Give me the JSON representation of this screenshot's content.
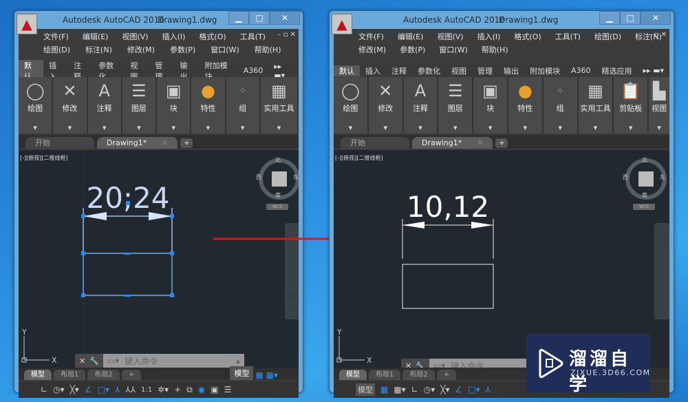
{
  "windows": [
    {
      "title": "Autodesk AutoCAD 2016",
      "doc": "Drawing1.dwg",
      "menu_row1": [
        "文件(F)",
        "编辑(E)",
        "视图(V)",
        "插入(I)",
        "格式(O)",
        "工具(T)"
      ],
      "menu_row2": [
        "绘图(D)",
        "标注(N)",
        "修改(M)",
        "参数(P)",
        "窗口(W)",
        "帮助(H)"
      ],
      "ribbon_tabs": [
        "默认",
        "插入",
        "注释",
        "参数化",
        "视图",
        "管理",
        "输出",
        "附加模块",
        "A360"
      ],
      "panels": [
        "绘图",
        "修改",
        "注释",
        "图层",
        "块",
        "特性",
        "组",
        "实用工具"
      ],
      "doc_tabs": [
        "开始",
        "Drawing1*"
      ],
      "viewport_label": "[-][俯视][二维线框]",
      "dimension_text": "20;24",
      "compass": {
        "n": "北",
        "s": "南",
        "e": "东",
        "w": "西",
        "wcs": "WCS"
      },
      "command_placeholder": "键入命令",
      "layout_tabs": [
        "模型",
        "布局1",
        "布局2"
      ],
      "status_model": "模型",
      "scale": "1:1",
      "ucs_x": "X",
      "ucs_y": "Y"
    },
    {
      "title": "Autodesk AutoCAD 2016",
      "doc": "Drawing1.dwg",
      "menu_row1": [
        "文件(F)",
        "编辑(E)",
        "视图(V)",
        "插入(I)",
        "格式(O)",
        "工具(T)",
        "绘图(D)",
        "标注(N)"
      ],
      "menu_row2": [
        "修改(M)",
        "参数(P)",
        "窗口(W)",
        "帮助(H)"
      ],
      "ribbon_tabs": [
        "默认",
        "插入",
        "注释",
        "参数化",
        "视图",
        "管理",
        "输出",
        "附加模块",
        "A360",
        "精选应用"
      ],
      "panels": [
        "绘图",
        "修改",
        "注释",
        "图层",
        "块",
        "特性",
        "组",
        "实用工具",
        "剪贴板",
        "视图"
      ],
      "doc_tabs": [
        "开始",
        "Drawing1*"
      ],
      "viewport_label": "[-][俯视][二维线框]",
      "dimension_text": "10,12",
      "compass": {
        "n": "北",
        "s": "南",
        "e": "东",
        "w": "西",
        "wcs": "WCS"
      },
      "command_placeholder": "键入命令",
      "layout_tabs": [
        "模型",
        "布局1",
        "布局2"
      ],
      "status_model": "模型",
      "ucs_x": "X",
      "ucs_y": "Y"
    }
  ],
  "watermark": {
    "name": "溜溜自学",
    "url": "ZIXUE.3D66.COM"
  },
  "colors": {
    "arrow": "#e0141e",
    "selection": "#3a8cf0",
    "canvas": "#212830"
  }
}
